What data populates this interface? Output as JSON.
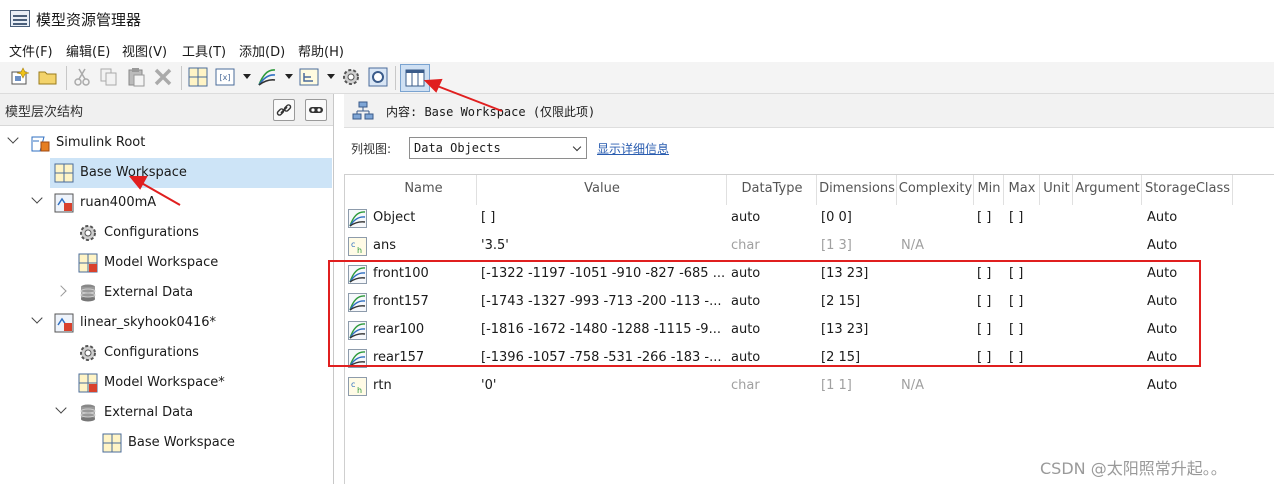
{
  "window": {
    "title": "模型资源管理器"
  },
  "menu": [
    "文件(F)",
    "编辑(E)",
    "视图(V)",
    "工具(T)",
    "添加(D)",
    "帮助(H)"
  ],
  "toolbar": {
    "icons": [
      "new-model-icon",
      "open-icon",
      "cut-icon",
      "copy-icon",
      "paste-icon",
      "delete-icon",
      "grid-icon",
      "add-parameter-icon",
      "add-signal-icon",
      "add-datatype-icon",
      "config-icon",
      "settings-icon",
      "column-view-icon"
    ]
  },
  "left": {
    "header": "模型层次结构",
    "tree": [
      {
        "label": "Simulink Root",
        "icon": "simulink-root-icon",
        "level": 0,
        "twisty": "open"
      },
      {
        "label": "Base Workspace",
        "icon": "workspace-icon",
        "level": 1,
        "twisty": "none",
        "selected": true
      },
      {
        "label": "ruan400mA",
        "icon": "model-icon",
        "level": 1,
        "twisty": "open"
      },
      {
        "label": "Configurations",
        "icon": "configurations-icon",
        "level": 2,
        "twisty": "none"
      },
      {
        "label": "Model Workspace",
        "icon": "model-workspace-icon",
        "level": 2,
        "twisty": "none"
      },
      {
        "label": "External Data",
        "icon": "external-data-icon",
        "level": 2,
        "twisty": "closed"
      },
      {
        "label": "linear_skyhook0416*",
        "icon": "model-icon",
        "level": 1,
        "twisty": "open"
      },
      {
        "label": "Configurations",
        "icon": "configurations-icon",
        "level": 2,
        "twisty": "none"
      },
      {
        "label": "Model Workspace*",
        "icon": "model-workspace-icon",
        "level": 2,
        "twisty": "none"
      },
      {
        "label": "External Data",
        "icon": "external-data-icon",
        "level": 2,
        "twisty": "open"
      },
      {
        "label": "Base Workspace",
        "icon": "workspace-icon",
        "level": 3,
        "twisty": "none"
      }
    ]
  },
  "right": {
    "content_label": "内容: Base Workspace (仅限此项)",
    "column_view_label": "列视图:",
    "column_view_value": "Data Objects",
    "show_details": "显示详细信息",
    "columns": [
      "Name",
      "Value",
      "DataType",
      "Dimensions",
      "Complexity",
      "Min",
      "Max",
      "Unit",
      "Argument",
      "StorageClass"
    ],
    "rows": [
      {
        "icon": "signal-object-icon",
        "name": "Object",
        "value": "[ ]",
        "datatype": "auto",
        "dimensions": "[0 0]",
        "complexity": "",
        "min": "[ ]",
        "max": "[ ]",
        "storage": "Auto",
        "dim": false
      },
      {
        "icon": "char-variable-icon",
        "name": "ans",
        "value": "'3.5'",
        "datatype": "char",
        "dimensions": "[1 3]",
        "complexity": "N/A",
        "min": "",
        "max": "",
        "storage": "Auto",
        "dim": true
      },
      {
        "icon": "signal-object-icon",
        "name": "front100",
        "value": "[-1322 -1197 -1051 -910 -827 -685 ...",
        "datatype": "auto",
        "dimensions": "[13 23]",
        "complexity": "",
        "min": "[ ]",
        "max": "[ ]",
        "storage": "Auto",
        "dim": false
      },
      {
        "icon": "signal-object-icon",
        "name": "front157",
        "value": "[-1743 -1327 -993 -713 -200 -113 -...",
        "datatype": "auto",
        "dimensions": "[2 15]",
        "complexity": "",
        "min": "[ ]",
        "max": "[ ]",
        "storage": "Auto",
        "dim": false
      },
      {
        "icon": "signal-object-icon",
        "name": "rear100",
        "value": "[-1816 -1672 -1480 -1288 -1115 -9...",
        "datatype": "auto",
        "dimensions": "[13 23]",
        "complexity": "",
        "min": "[ ]",
        "max": "[ ]",
        "storage": "Auto",
        "dim": false
      },
      {
        "icon": "signal-object-icon",
        "name": "rear157",
        "value": "[-1396 -1057 -758 -531 -266 -183 -...",
        "datatype": "auto",
        "dimensions": "[2 15]",
        "complexity": "",
        "min": "[ ]",
        "max": "[ ]",
        "storage": "Auto",
        "dim": false
      },
      {
        "icon": "char-variable-icon",
        "name": "rtn",
        "value": "'0'",
        "datatype": "char",
        "dimensions": "[1 1]",
        "complexity": "N/A",
        "min": "",
        "max": "",
        "storage": "Auto",
        "dim": true
      }
    ]
  },
  "watermark": "CSDN @太阳照常升起。。",
  "colors": {
    "selection": "#cde4f7",
    "annotation": "#e01f1f",
    "link": "#2a5db0"
  }
}
